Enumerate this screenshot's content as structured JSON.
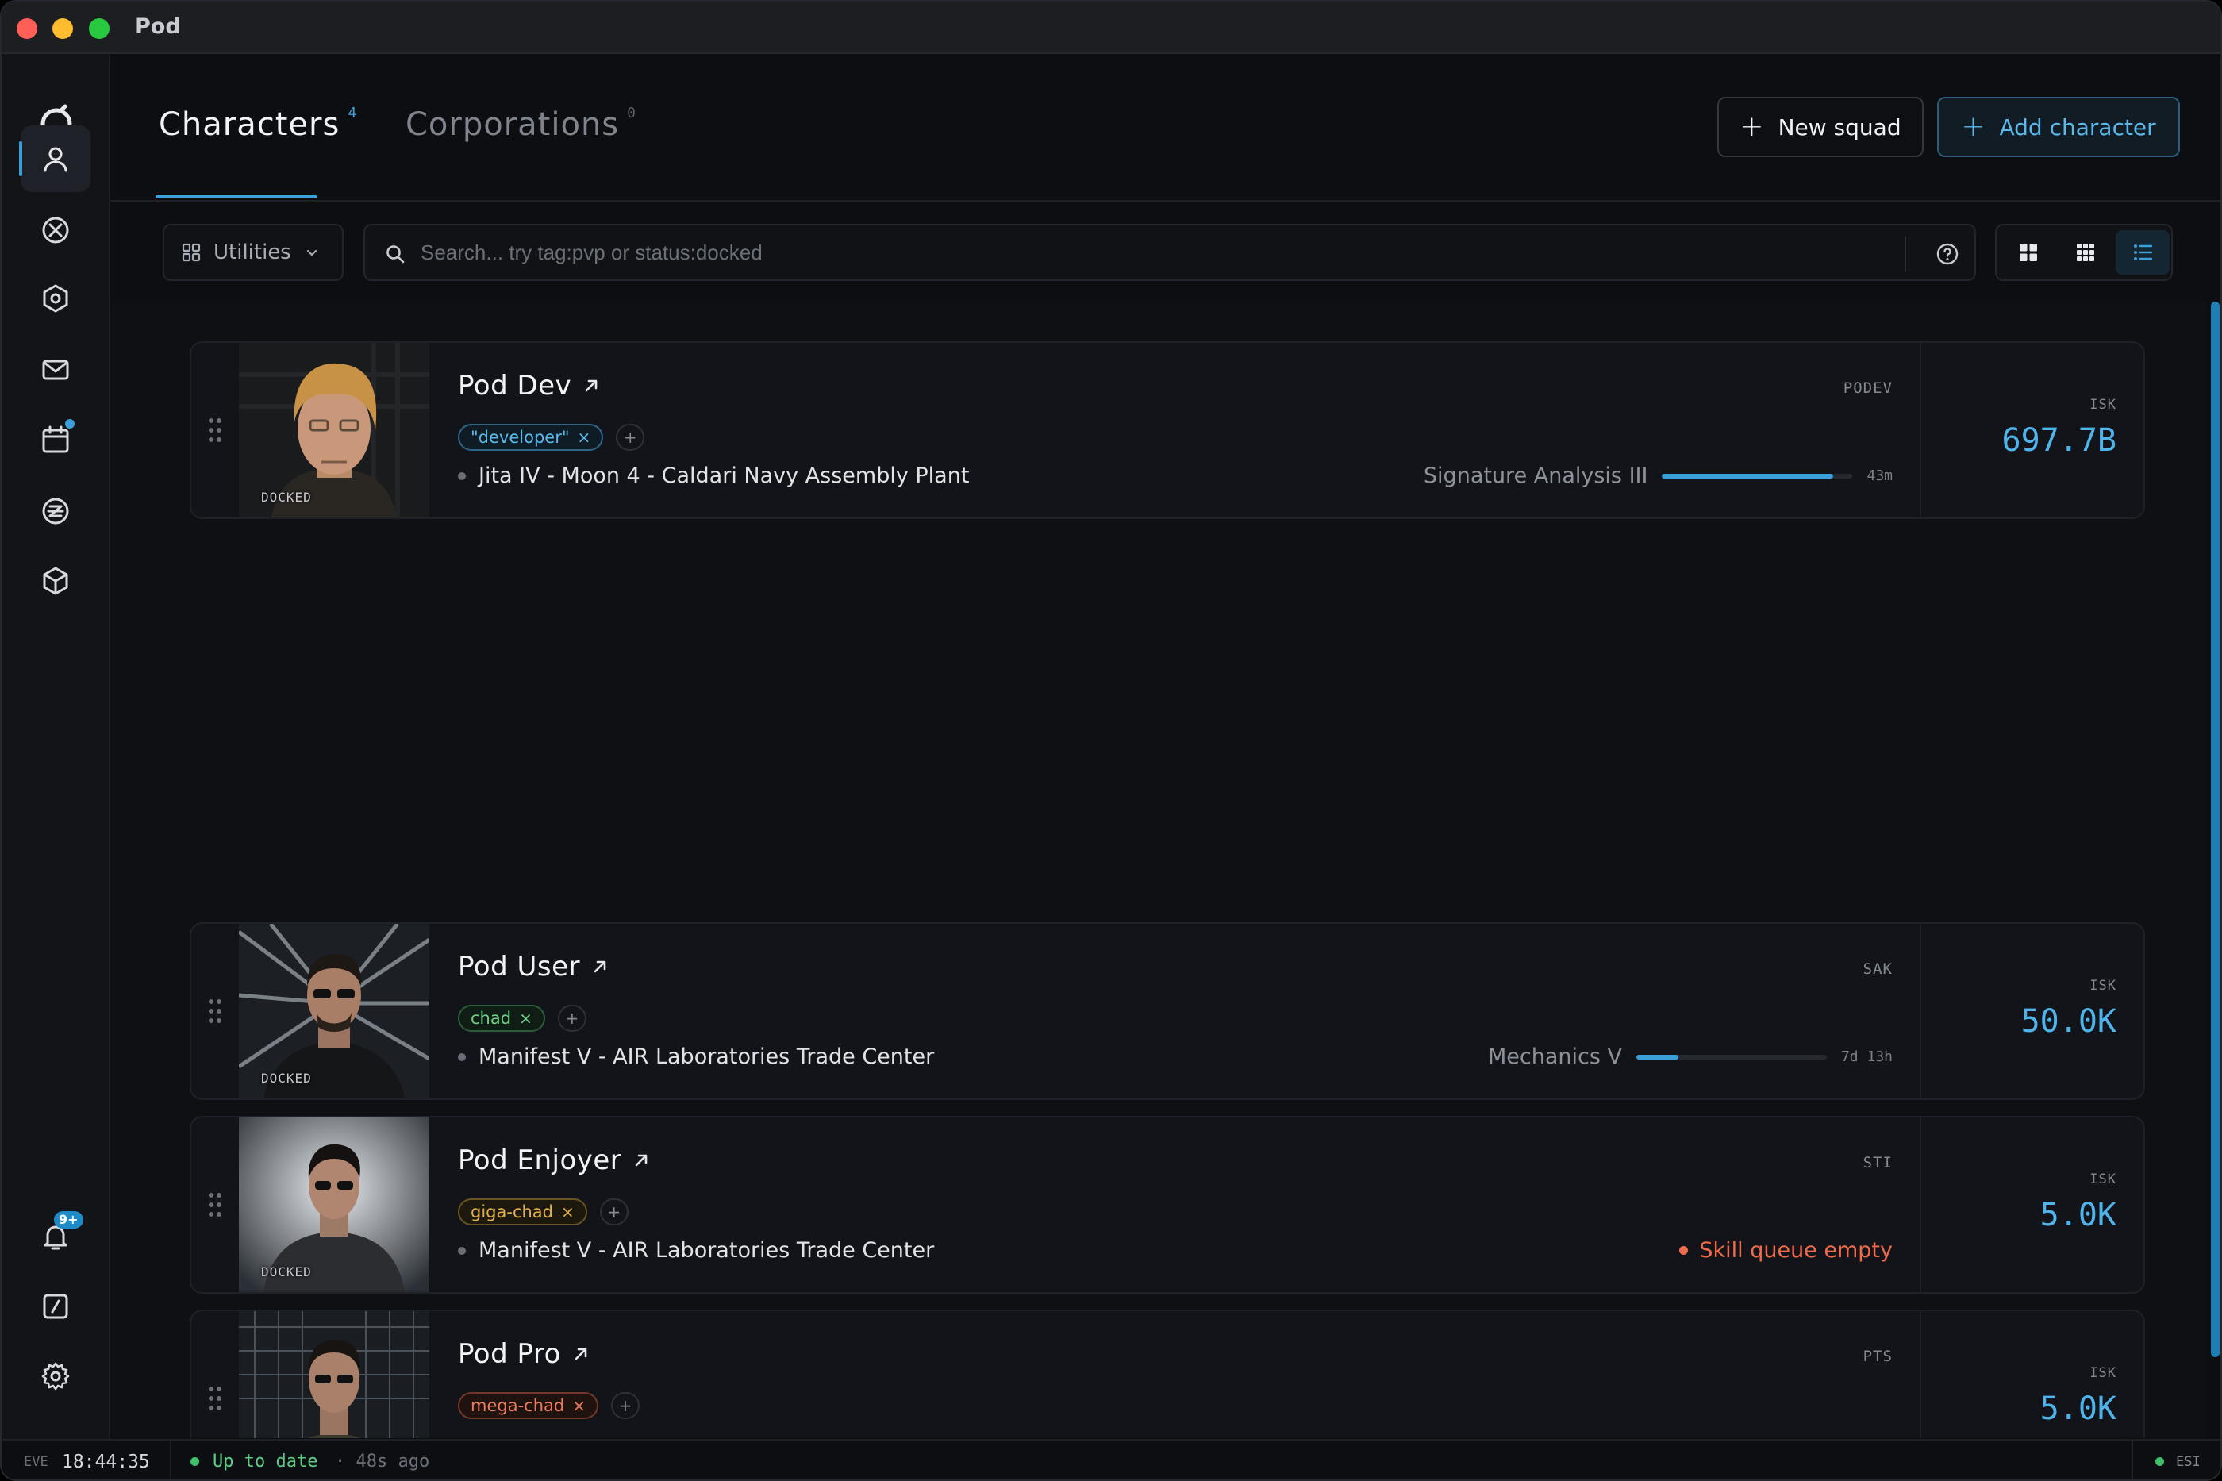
{
  "window": {
    "title": "Pod"
  },
  "sidebar": {
    "items": [
      {
        "name": "characters",
        "icon": "user-icon",
        "active": true
      },
      {
        "name": "killboard",
        "icon": "crossed-circle-icon"
      },
      {
        "name": "fittings",
        "icon": "hexagon-icon"
      },
      {
        "name": "mail",
        "icon": "mail-icon"
      },
      {
        "name": "calendar",
        "icon": "calendar-icon",
        "dot": true
      },
      {
        "name": "wallet",
        "icon": "zkill-icon"
      },
      {
        "name": "assets",
        "icon": "cube-icon"
      }
    ],
    "bottom": {
      "notifications_badge": "9+",
      "items": [
        "bell-icon",
        "slash-box-icon",
        "gear-icon"
      ]
    }
  },
  "header": {
    "tabs": [
      {
        "label": "Characters",
        "count": "4",
        "active": true
      },
      {
        "label": "Corporations",
        "count": "0",
        "active": false
      }
    ],
    "new_squad_label": "New squad",
    "add_character_label": "Add character"
  },
  "toolbar": {
    "utilities_label": "Utilities",
    "search_placeholder": "Search... try tag:pvp or status:docked",
    "view_modes": [
      "large-grid",
      "small-grid",
      "list"
    ],
    "active_view": "list"
  },
  "characters": [
    {
      "name": "Pod Dev",
      "ticker": "PODEV",
      "tag": "\"developer\"",
      "tag_color": "blue",
      "status": "DOCKED",
      "location": "Jita IV - Moon 4 - Caldari Navy Assembly Plant",
      "skill": "Signature Analysis III",
      "skill_progress": 0.9,
      "skill_time": "43m",
      "isk_label": "ISK",
      "isk": "697.7B"
    },
    {
      "name": "Pod User",
      "ticker": "SAK",
      "tag": "chad",
      "tag_color": "green",
      "status": "DOCKED",
      "location": "Manifest V - AIR Laboratories Trade Center",
      "skill": "Mechanics V",
      "skill_progress": 0.22,
      "skill_time": "7d 13h",
      "isk_label": "ISK",
      "isk": "50.0K"
    },
    {
      "name": "Pod Enjoyer",
      "ticker": "STI",
      "tag": "giga-chad",
      "tag_color": "gold",
      "status": "DOCKED",
      "location": "Manifest V - AIR Laboratories Trade Center",
      "skill_warning": "Skill queue empty",
      "isk_label": "ISK",
      "isk": "5.0K"
    },
    {
      "name": "Pod Pro",
      "ticker": "PTS",
      "tag": "mega-chad",
      "tag_color": "red",
      "isk_label": "ISK",
      "isk": "5.0K"
    }
  ],
  "statusbar": {
    "eve_label": "EVE",
    "time": "18:44:35",
    "status": "Up to date",
    "ago": "· 48s ago",
    "esi_label": "ESI"
  },
  "colors": {
    "accent": "#3ca0d8",
    "background": "#0c0e12",
    "card": "#12141a",
    "success": "#3fbf6a",
    "warning": "#ef6a4a"
  }
}
